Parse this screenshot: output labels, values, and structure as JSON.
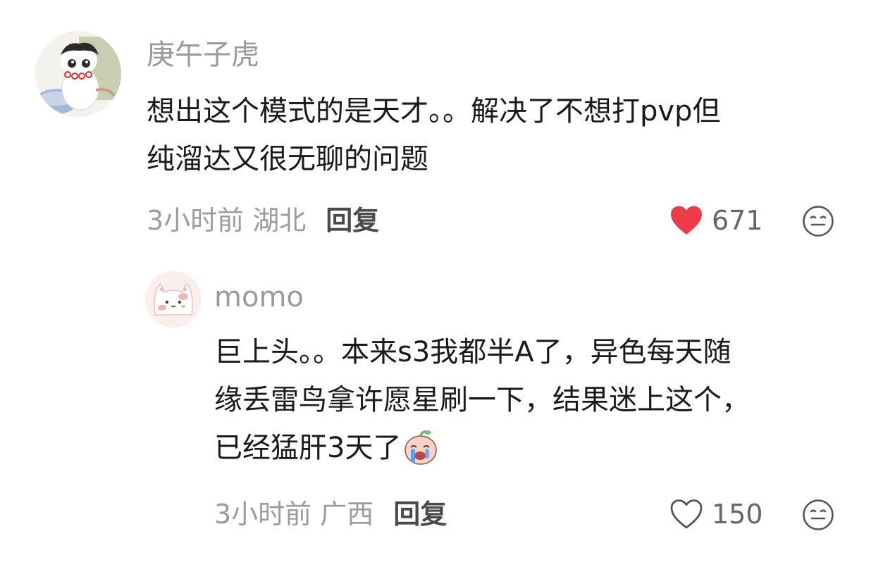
{
  "comments": [
    {
      "username": "庚午子虎",
      "text_line1": "想出这个模式的是天才。。解决了不想打pvp但",
      "text_line2": "纯溜达又很无聊的问题",
      "time": "3小时前",
      "location": "湖北",
      "reply_label": "回复",
      "likes": "671",
      "liked": true
    }
  ],
  "replies": [
    {
      "username": "momo",
      "text_line1": "巨上头。。本来s3我都半A了，异色每天随",
      "text_line2": "缘丢雷鸟拿许愿星刷一下，结果迷上这个，",
      "text_line3": "已经猛肝3天了",
      "time": "3小时前",
      "location": "广西",
      "reply_label": "回复",
      "likes": "150",
      "liked": false
    }
  ],
  "colors": {
    "like_active": "#ee3b4b",
    "muted_text": "#9c9c9c",
    "body_text": "#1a1a1a"
  },
  "icons": {
    "liked": "heart-filled-icon",
    "unliked": "heart-outline-icon",
    "emoji": "emoji-face-icon",
    "sticker": "crying-sticker"
  }
}
